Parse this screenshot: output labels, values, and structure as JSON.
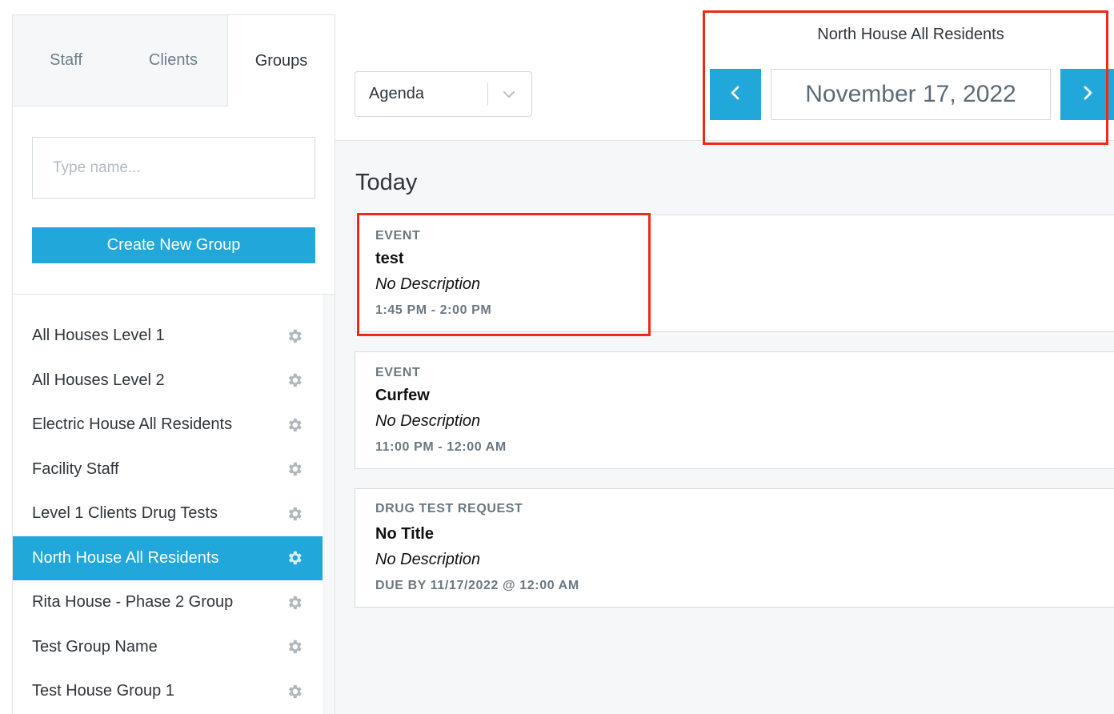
{
  "sidebar": {
    "tabs": [
      {
        "label": "Staff"
      },
      {
        "label": "Clients"
      },
      {
        "label": "Groups"
      }
    ],
    "active_tab": "Groups",
    "search": {
      "placeholder": "Type name...",
      "value": ""
    },
    "create_button": "Create New Group",
    "groups": [
      {
        "name": "All Houses Level 1"
      },
      {
        "name": "All Houses Level 2"
      },
      {
        "name": "Electric House All Residents"
      },
      {
        "name": "Facility Staff"
      },
      {
        "name": "Level 1 Clients Drug Tests"
      },
      {
        "name": "North House All Residents"
      },
      {
        "name": "Rita House - Phase 2 Group"
      },
      {
        "name": "Test Group Name"
      },
      {
        "name": "Test House Group 1"
      }
    ],
    "selected_group": "North House All Residents"
  },
  "toolbar": {
    "view_select": {
      "value": "Agenda"
    },
    "group_title": "North House All Residents",
    "date": "November 17, 2022"
  },
  "agenda": {
    "heading": "Today",
    "items": [
      {
        "type": "EVENT",
        "title": "test",
        "description": "No Description",
        "time": "1:45 PM - 2:00 PM"
      },
      {
        "type": "EVENT",
        "title": "Curfew",
        "description": "No Description",
        "time": "11:00 PM - 12:00 AM"
      },
      {
        "type": "DRUG TEST REQUEST",
        "title": "No Title",
        "description": "No Description",
        "time": "DUE BY 11/17/2022 @ 12:00 AM"
      }
    ]
  },
  "colors": {
    "accent": "#22a7da",
    "highlight": "#ee2a16",
    "background": "#f6f7f8"
  },
  "icons": {
    "gear": "gear-icon",
    "chevron_left": "chevron-left-icon",
    "chevron_right": "chevron-right-icon",
    "chevron_down": "chevron-down-icon"
  }
}
